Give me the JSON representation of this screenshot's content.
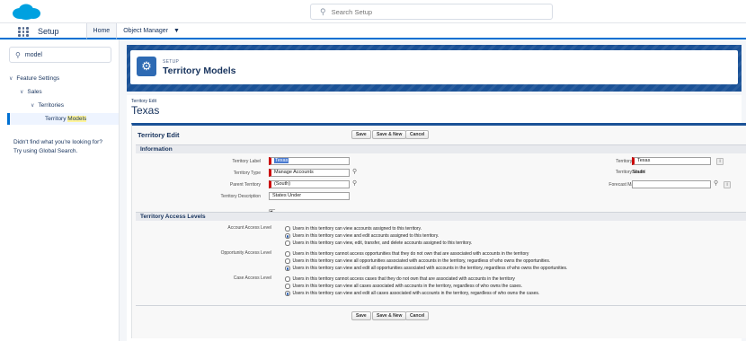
{
  "header": {
    "search_placeholder": "Search Setup"
  },
  "nav": {
    "app_name": "Setup",
    "tabs": [
      {
        "label": "Home"
      },
      {
        "label": "Object Manager"
      }
    ]
  },
  "sidebar": {
    "search_value": "model",
    "tree": [
      {
        "label": "Feature Settings"
      },
      {
        "label": "Sales"
      },
      {
        "label": "Territories"
      }
    ],
    "selected_prefix": "Territory ",
    "selected_highlight": "Models",
    "help_line1": "Didn't find what you're looking for?",
    "help_line2": "Try using Global Search."
  },
  "page_header": {
    "supertitle": "SETUP",
    "title": "Territory Models"
  },
  "record": {
    "crumb": "Territory Edit",
    "name": "Texas",
    "block_title": "Territory Edit",
    "buttons": {
      "save": "Save",
      "save_new": "Save & New",
      "cancel": "Cancel"
    },
    "info_section": "Information",
    "fields": {
      "label_label": "Territory Label",
      "label_value": "Texas",
      "type_label": "Territory Type",
      "type_value": "Manage Accounts",
      "parent_label": "Parent Territory",
      "parent_value": "(South)",
      "desc_label": "Territory Description",
      "desc_value": "States Under",
      "name_label": "Territory Name",
      "name_value": "Texas",
      "model_label": "Territory Model",
      "model_value": "South",
      "forecast_label": "Forecast Manager",
      "forecast_value": ""
    },
    "access_section": "Territory Access Levels",
    "account_access": {
      "label": "Account Access Level",
      "options": [
        "Users in this territory can view accounts assigned to this territory.",
        "Users in this territory can view and edit accounts assigned to this territory.",
        "Users in this territory can view, edit, transfer, and delete accounts assigned to this territory."
      ],
      "selected": 1
    },
    "opportunity_access": {
      "label": "Opportunity Access Level",
      "options": [
        "Users in this territory cannot access opportunities that they do not own that are associated with accounts in the territory",
        "Users in this territory can view all opportunities associated with accounts in the territory, regardless of who owns the opportunities.",
        "Users in this territory can view and edit all opportunities associated with accounts in the territory, regardless of who owns the opportunities."
      ],
      "selected": 2
    },
    "case_access": {
      "label": "Case Access Level",
      "options": [
        "Users in this territory cannot access cases that they do not own that are associated with accounts in the territory",
        "Users in this territory can view all cases associated with accounts in the territory, regardless of who owns the cases.",
        "Users in this territory can view and edit all cases associated with accounts in the territory, regardless of who owns the cases."
      ],
      "selected": 2
    }
  },
  "colors": {
    "brand_blue": "#0070d2",
    "banner_blue": "#1b5297",
    "required_red": "#cc0000"
  }
}
